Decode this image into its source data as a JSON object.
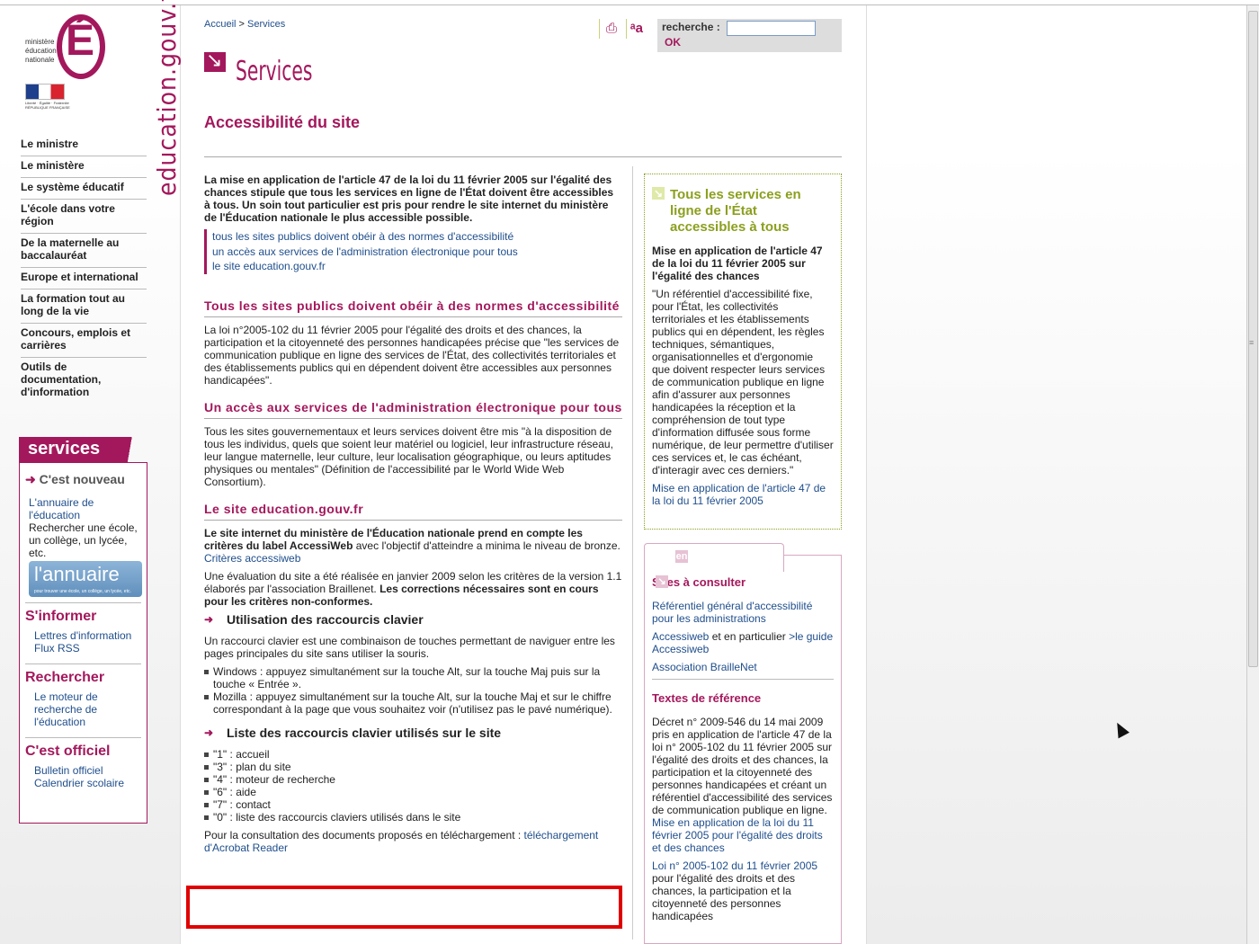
{
  "logo": {
    "letter": "É",
    "ministry": "ministère éducation nationale",
    "republic": "Liberté · Égalité · Fraternité RÉPUBLIQUE FRANÇAISE",
    "site_vertical": "education.gouv.fr"
  },
  "left_nav": [
    "Le ministre",
    "Le ministère",
    "Le système éducatif",
    "L'école dans votre région",
    "De la maternelle au baccalauréat",
    "Europe et international",
    "La formation tout au long de la vie",
    "Concours, emplois et carrières",
    "Outils de documentation, d'information"
  ],
  "services": {
    "header": "services",
    "new_title": "C'est nouveau",
    "annuaire_link": "L'annuaire de l'éducation",
    "annuaire_text": "Rechercher une école, un collège, un lycée, etc.",
    "annuaire_banner": "l'annuaire",
    "annuaire_banner_sub": "pour trouver une école, un collège, un lycée, etc.",
    "sinformer": "S'informer",
    "sinformer_links": [
      "Lettres d'information",
      "Flux RSS"
    ],
    "rechercher": "Rechercher",
    "rechercher_link": "Le moteur de recherche de l'éducation",
    "officiel": "C'est officiel",
    "officiel_links": [
      "Bulletin officiel",
      "Calendrier scolaire"
    ]
  },
  "breadcrumb": {
    "home": "Accueil",
    "sep": ">",
    "current": "Services"
  },
  "search": {
    "label": "recherche :",
    "ok": "OK",
    "value": ""
  },
  "section_title": "Services",
  "page_title": "Accessibilité du site",
  "main": {
    "intro": "La mise en application de l'article 47 de la loi du 11 février 2005 sur l'égalité des chances stipule que tous les services en ligne de l'État doivent être accessibles à tous. Un soin tout particulier est pris pour rendre le site internet du ministère de l'Éducation nationale le plus accessible possible.",
    "toc": [
      "tous les sites publics doivent obéir à des normes d'accessibilité",
      "un accès aux services de l'administration électronique pour tous",
      "le site education.gouv.fr"
    ],
    "h_norms": "Tous les sites publics doivent obéir à des normes d'accessibilité",
    "p_norms": "La loi n°2005-102 du 11 février 2005 pour l'égalité des droits et des chances, la participation et la citoyenneté des personnes handicapées précise que \"les services de communication publique en ligne des services de l'État, des collectivités territoriales et des établissements publics qui en dépendent doivent être accessibles aux personnes handicapées\".",
    "h_access": "Un accès aux services de l'administration électronique pour tous",
    "p_access": "Tous les sites gouvernementaux et leurs services doivent être mis \"à la disposition de tous les individus, quels que soient leur matériel ou logiciel, leur infrastructure réseau, leur langue maternelle, leur culture, leur localisation géographique, ou leurs aptitudes physiques ou mentales\" (Définition de l'accessibilité par le World Wide Web Consortium).",
    "h_site": "Le site education.gouv.fr",
    "p_site_bold": "Le site internet du ministère de l'Éducation nationale prend en compte les critères du label AccessiWeb",
    "p_site_rest": " avec l'objectif d'atteindre a minima le niveau de bronze.",
    "p_site_link": "Critères accessiweb",
    "p_eval": "Une évaluation du site a été réalisée en janvier 2009 selon les critères de la version 1.1 élaborés par l'association Braillenet. ",
    "p_eval_bold": "Les corrections nécessaires sont en cours pour les critères non-conformes.",
    "h_shortcuts": "Utilisation des raccourcis clavier",
    "p_shortcuts": "Un raccourci clavier est une combinaison de touches permettant de naviguer entre les pages principales du site sans utiliser la souris.",
    "shortcut_browsers": [
      "Windows : appuyez simultanément sur la touche Alt, sur la touche Maj  puis sur la touche « Entrée ».",
      "Mozilla : appuyez simultanément sur la touche Alt, sur la touche Maj et sur le chiffre correspondant à la page que vous souhaitez voir (n'utilisez pas le pavé numérique)."
    ],
    "h_list": "Liste des raccourcis clavier utilisés sur le site",
    "shortcut_list": [
      "\"1\" : accueil",
      "\"3\" : plan du site",
      "\"4\" : moteur de recherche",
      "\"6\" : aide",
      "\"7\" : contact",
      "\"0\" : liste des raccourcis claviers utilisés dans le site"
    ],
    "p_download": "Pour la consultation des documents proposés en téléchargement : ",
    "p_download_link": "téléchargement d'Acrobat Reader"
  },
  "right1": {
    "title": "Tous les services en ligne de l'État accessibles à tous",
    "subtitle": "Mise en application de l'article 47 de la loi du 11 février 2005 sur l'égalité des chances",
    "quote": "\"Un référentiel d'accessibilité fixe, pour l'État, les collectivités territoriales et les établissements publics qui en dépendent, les règles techniques, sémantiques, organisationnelles et d'ergonomie que doivent respecter leurs services de communication publique en ligne afin d'assurer aux personnes handicapées la réception et la compréhension de tout type d'information diffusée sous forme numérique, de leur permettre d'utiliser ces services et, le cas échéant, d'interagir avec ces derniers.\"",
    "link": "Mise en application de l'article 47 de la loi du 11 février 2005"
  },
  "right2": {
    "tab": "en savoir +",
    "h_sites": "Sites à consulter",
    "link_ref": "Référentiel général d'accessibilité pour les administrations",
    "link_aw": "Accessiweb",
    "text_aw": " et en particulier ",
    "link_guide": ">le guide Accessiweb",
    "link_bn": "Association BrailleNet",
    "h_texts": "Textes de référence",
    "decret": "Décret n° 2009-546 du 14 mai 2009 pris en application de l'article 47 de la loi n° 2005-102 du 11 février 2005 sur l'égalité des droits et des chances, la participation et la citoyenneté des personnes handicapées et créant un référentiel d'accessibilité des services de communication publique en ligne.",
    "link_loi": "Mise en application de la loi du 11 février 2005 pour l'égalité des droits et des chances",
    "link_loi2": "Loi n° 2005-102 du 11 février 2005",
    "loi2_text": " pour l'égalité des droits et des chances, la participation et la citoyenneté des personnes handicapées"
  },
  "colors": {
    "brand": "#a3185c",
    "green": "#8c9f1e",
    "link": "#1f4e8c",
    "highlight": "#e00000"
  }
}
